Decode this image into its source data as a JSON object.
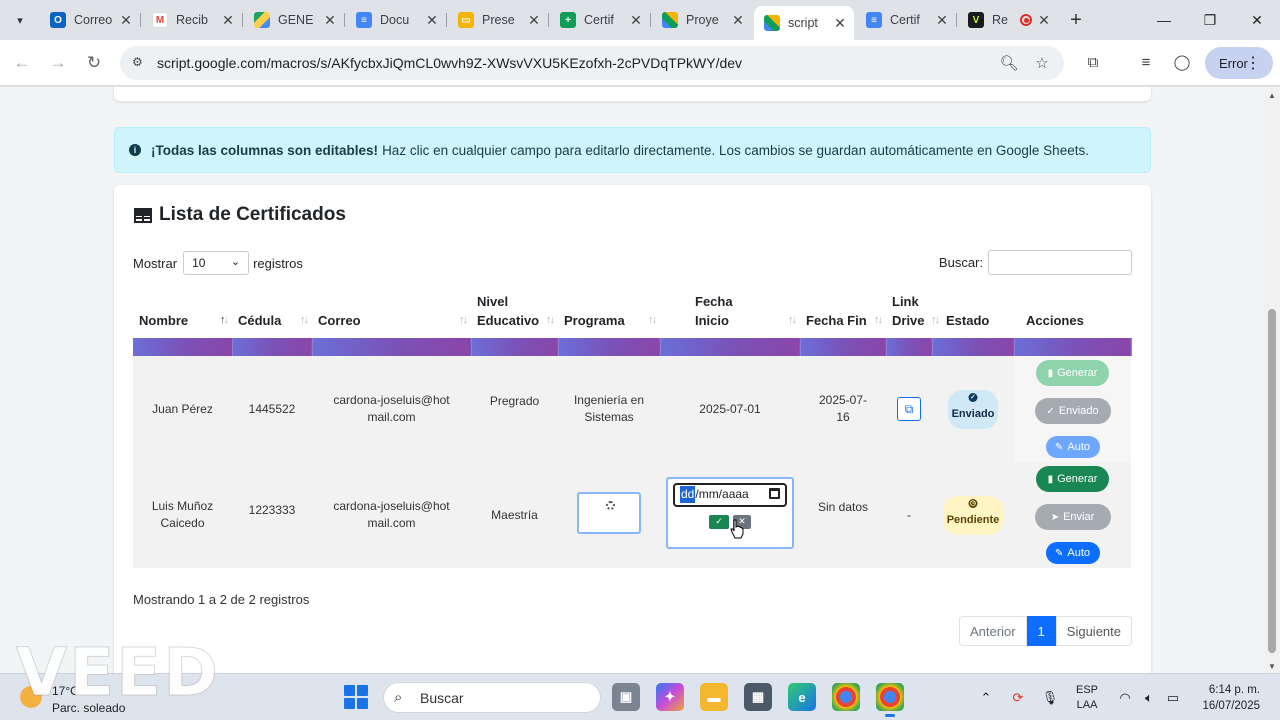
{
  "browser": {
    "tabs": [
      {
        "label": "Correo",
        "icon": "outlook-icon",
        "color": "#0a64c2"
      },
      {
        "label": "Recib",
        "icon": "gmail-icon",
        "color": "#ea4335"
      },
      {
        "label": "GENE",
        "icon": "google-drive-icon",
        "color": "#1fa463"
      },
      {
        "label": "Docu",
        "icon": "google-docs-icon",
        "color": "#4285f4"
      },
      {
        "label": "Prese",
        "icon": "google-slides-icon",
        "color": "#f4b400"
      },
      {
        "label": "Certif",
        "icon": "google-sheets-icon",
        "color": "#0f9d58"
      },
      {
        "label": "Proye",
        "icon": "apps-script-icon",
        "color": "#f4b400"
      },
      {
        "label": "script",
        "icon": "apps-script-icon",
        "color": "#f4b400",
        "active": true
      },
      {
        "label": "Certif",
        "icon": "google-docs-icon",
        "color": "#4285f4"
      },
      {
        "label": "Re",
        "icon": "veed-icon",
        "color": "#1a1a1a"
      }
    ],
    "url": "script.google.com/macros/s/AKfycbxJiQmCL0wvh9Z-XWsvVXU5KEzofxh-2cPVDqTPkWY/dev",
    "profile_button": "Error"
  },
  "alert": {
    "bold": "¡Todas las columnas son editables!",
    "text": "Haz clic en cualquier campo para editarlo directamente. Los cambios se guardan automáticamente en Google Sheets."
  },
  "card": {
    "title": "Lista de Certificados",
    "show_label": "Mostrar",
    "show_value": "10",
    "records_label": "registros",
    "search_label": "Buscar:"
  },
  "table": {
    "columns": [
      "Nombre",
      "Cédula",
      "Correo",
      "Nivel Educativo",
      "Programa",
      "Fecha Inicio",
      "Fecha Fin",
      "Link Drive",
      "Estado",
      "Acciones"
    ],
    "rows": [
      {
        "nombre": "Juan Pérez",
        "cedula": "1445522",
        "correo": "cardona-joseluis@hotmail.com",
        "nivel": "Pregrado",
        "programa": "Ingeniería en Sistemas",
        "fecha_inicio": "2025-07-01",
        "fecha_fin": "2025-07-16",
        "estado": "Enviado",
        "btn_generar": "Generar",
        "btn_enviar": "Enviado",
        "btn_auto": "Auto"
      },
      {
        "nombre": "Luis Muñoz Caicedo",
        "cedula": "1223333",
        "correo": "cardona-joseluis@hotmail.com",
        "nivel": "Maestría",
        "date_placeholder_hl": "dd",
        "date_placeholder_rest": "/mm/aaaa",
        "fecha_fin": "Sin datos",
        "link_drive": "-",
        "estado": "Pendiente",
        "btn_generar": "Generar",
        "btn_enviar": "Enviar",
        "btn_auto": "Auto"
      }
    ]
  },
  "footer": {
    "info": "Mostrando 1 a 2 de 2 registros",
    "prev": "Anterior",
    "page": "1",
    "next": "Siguiente"
  },
  "watermark": "VEED",
  "taskbar": {
    "weather_temp": "17°C",
    "weather_desc": "Parc. soleado",
    "search_placeholder": "Buscar",
    "lang_1": "ESP",
    "lang_2": "LAA",
    "time": "6:14 p. m.",
    "date": "16/07/2025"
  }
}
